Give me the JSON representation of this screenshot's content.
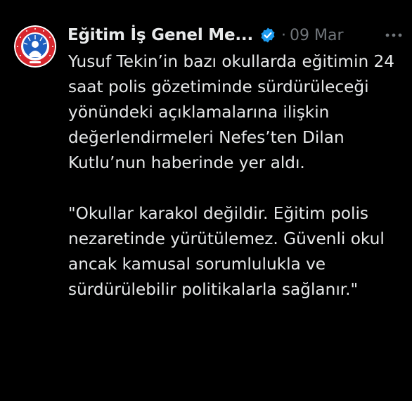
{
  "tweet": {
    "author_name": "Eğitim İş Genel Me...",
    "verified_icon": "verified-badge-icon",
    "dot": "·",
    "date": "09 Mar",
    "more_icon": "more-options-icon",
    "avatar_icon": "union-logo-avatar",
    "paragraphs": [
      "Yusuf Tekin’in bazı okullarda eğitimin 24 saat polis gözetiminde sürdürüleceği yönündeki açıklamalarına ilişkin değerlendirmeleri Nefes’ten Dilan Kutlu’nun haberinde yer aldı.",
      "\"Okullar karakol değildir. Eğitim polis nezaretinde yürütülemez. Güvenli okul ancak kamusal sorumlulukla ve sürdürülebilir politikalarla sağlanır.\""
    ]
  },
  "colors": {
    "background": "#000000",
    "text_primary": "#e7e9ea",
    "text_secondary": "#71767b",
    "verified_blue": "#1d9bf0",
    "avatar_red": "#d7262d",
    "avatar_blue": "#1f5fbf"
  }
}
